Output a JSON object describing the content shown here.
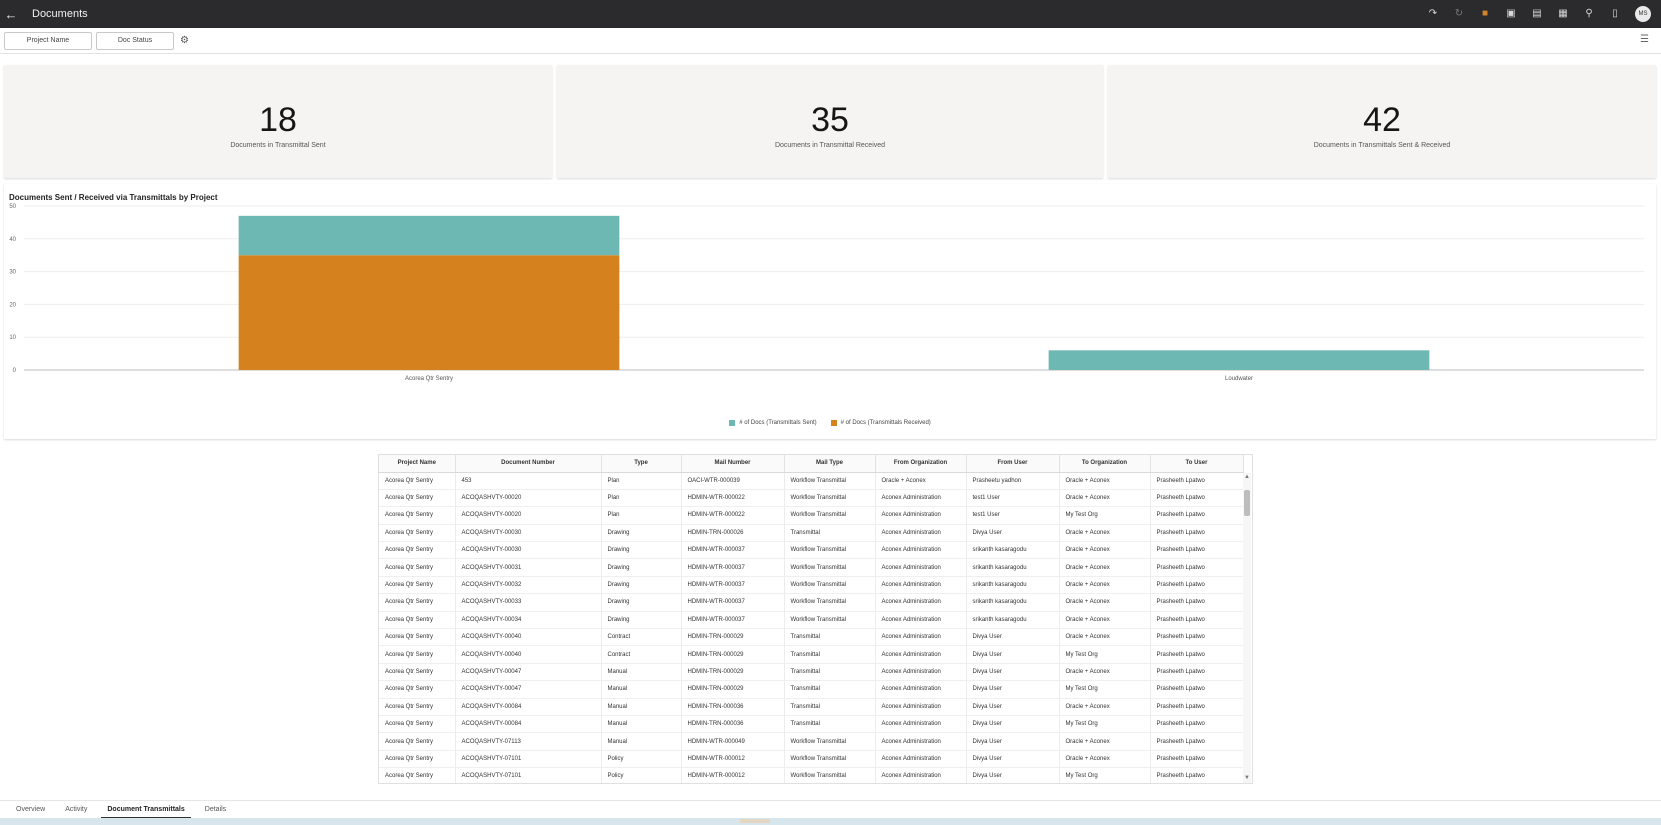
{
  "header": {
    "title": "Documents",
    "back_icon": "back-arrow-icon",
    "avatar_initials": "MS",
    "icons": [
      "share-icon",
      "redo-icon",
      "bookmark-icon",
      "present-icon",
      "notes-icon",
      "calendar-icon",
      "user-icon",
      "book-icon"
    ]
  },
  "filters": {
    "project_name": "Project Name",
    "doc_status": "Doc Status"
  },
  "kpis": [
    {
      "value": "18",
      "label": "Documents in Transmittal Sent"
    },
    {
      "value": "35",
      "label": "Documents in Transmittal Received"
    },
    {
      "value": "42",
      "label": "Documents in Transmittals Sent & Received"
    }
  ],
  "chart_data": {
    "type": "bar",
    "stacked": true,
    "title": "Documents Sent / Received via Transmittals by Project",
    "categories": [
      "Acorea Qtr Sentry",
      "Loudwater"
    ],
    "series": [
      {
        "name": "# of Docs (Transmittals Received)",
        "color": "#d5821e",
        "values": [
          35,
          0
        ]
      },
      {
        "name": "# of Docs (Transmittals Sent)",
        "color": "#6db8b3",
        "values": [
          12,
          6
        ]
      }
    ],
    "ylim": [
      0,
      50
    ],
    "yticks": [
      "0",
      "10",
      "20",
      "30",
      "40",
      "50"
    ],
    "legend_position": "bottom",
    "legend": [
      "# of Docs (Transmittals Sent)",
      "# of Docs (Transmittals Received)"
    ]
  },
  "table": {
    "columns": [
      "Project Name",
      "Document Number",
      "Type",
      "Mail Number",
      "Mail Type",
      "From Organization",
      "From User",
      "To Organization",
      "To User"
    ],
    "rows": [
      [
        "Acorea Qtr Sentry",
        "453",
        "Plan",
        "OACI-WTR-000039",
        "Workflow Transmittal",
        "Oracle + Aconex",
        "Prasheetu yadhon",
        "Oracle + Aconex",
        "Prasheeth Lpatwo"
      ],
      [
        "Acorea Qtr Sentry",
        "ACOQASHVTY-00020",
        "Plan",
        "HDMIN-WTR-000022",
        "Workflow Transmittal",
        "Aconex Administration",
        "test1 User",
        "Oracle + Aconex",
        "Prasheeth Lpatwo"
      ],
      [
        "Acorea Qtr Sentry",
        "ACOQASHVTY-00020",
        "Plan",
        "HDMIN-WTR-000022",
        "Workflow Transmittal",
        "Aconex Administration",
        "test1 User",
        "My Test Org",
        "Prasheeth Lpatwo"
      ],
      [
        "Acorea Qtr Sentry",
        "ACOQASHVTY-00030",
        "Drawing",
        "HDMIN-TRN-000026",
        "Transmittal",
        "Aconex Administration",
        "Divya User",
        "Oracle + Aconex",
        "Prasheeth Lpatwo"
      ],
      [
        "Acorea Qtr Sentry",
        "ACOQASHVTY-00030",
        "Drawing",
        "HDMIN-WTR-000037",
        "Workflow Transmittal",
        "Aconex Administration",
        "srikanth kasaragodu",
        "Oracle + Aconex",
        "Prasheeth Lpatwo"
      ],
      [
        "Acorea Qtr Sentry",
        "ACOQASHVTY-00031",
        "Drawing",
        "HDMIN-WTR-000037",
        "Workflow Transmittal",
        "Aconex Administration",
        "srikanth kasaragodu",
        "Oracle + Aconex",
        "Prasheeth Lpatwo"
      ],
      [
        "Acorea Qtr Sentry",
        "ACOQASHVTY-00032",
        "Drawing",
        "HDMIN-WTR-000037",
        "Workflow Transmittal",
        "Aconex Administration",
        "srikanth kasaragodu",
        "Oracle + Aconex",
        "Prasheeth Lpatwo"
      ],
      [
        "Acorea Qtr Sentry",
        "ACOQASHVTY-00033",
        "Drawing",
        "HDMIN-WTR-000037",
        "Workflow Transmittal",
        "Aconex Administration",
        "srikanth kasaragodu",
        "Oracle + Aconex",
        "Prasheeth Lpatwo"
      ],
      [
        "Acorea Qtr Sentry",
        "ACOQASHVTY-00034",
        "Drawing",
        "HDMIN-WTR-000037",
        "Workflow Transmittal",
        "Aconex Administration",
        "srikanth kasaragodu",
        "Oracle + Aconex",
        "Prasheeth Lpatwo"
      ],
      [
        "Acorea Qtr Sentry",
        "ACOQASHVTY-00040",
        "Contract",
        "HDMIN-TRN-000029",
        "Transmittal",
        "Aconex Administration",
        "Divya User",
        "Oracle + Aconex",
        "Prasheeth Lpatwo"
      ],
      [
        "Acorea Qtr Sentry",
        "ACOQASHVTY-00040",
        "Contract",
        "HDMIN-TRN-000029",
        "Transmittal",
        "Aconex Administration",
        "Divya User",
        "My Test Org",
        "Prasheeth Lpatwo"
      ],
      [
        "Acorea Qtr Sentry",
        "ACOQASHVTY-00047",
        "Manual",
        "HDMIN-TRN-000029",
        "Transmittal",
        "Aconex Administration",
        "Divya User",
        "Oracle + Aconex",
        "Prasheeth Lpatwo"
      ],
      [
        "Acorea Qtr Sentry",
        "ACOQASHVTY-00047",
        "Manual",
        "HDMIN-TRN-000029",
        "Transmittal",
        "Aconex Administration",
        "Divya User",
        "My Test Org",
        "Prasheeth Lpatwo"
      ],
      [
        "Acorea Qtr Sentry",
        "ACOQASHVTY-00084",
        "Manual",
        "HDMIN-TRN-000036",
        "Transmittal",
        "Aconex Administration",
        "Divya User",
        "Oracle + Aconex",
        "Prasheeth Lpatwo"
      ],
      [
        "Acorea Qtr Sentry",
        "ACOQASHVTY-00084",
        "Manual",
        "HDMIN-TRN-000036",
        "Transmittal",
        "Aconex Administration",
        "Divya User",
        "My Test Org",
        "Prasheeth Lpatwo"
      ],
      [
        "Acorea Qtr Sentry",
        "ACOQASHVTY-07113",
        "Manual",
        "HDMIN-WTR-000049",
        "Workflow Transmittal",
        "Aconex Administration",
        "Divya User",
        "Oracle + Aconex",
        "Prasheeth Lpatwo"
      ],
      [
        "Acorea Qtr Sentry",
        "ACOQASHVTY-07101",
        "Policy",
        "HDMIN-WTR-000012",
        "Workflow Transmittal",
        "Aconex Administration",
        "Divya User",
        "Oracle + Aconex",
        "Prasheeth Lpatwo"
      ],
      [
        "Acorea Qtr Sentry",
        "ACOQASHVTY-07101",
        "Policy",
        "HDMIN-WTR-000012",
        "Workflow Transmittal",
        "Aconex Administration",
        "Divya User",
        "My Test Org",
        "Prasheeth Lpatwo"
      ]
    ]
  },
  "tabs": [
    "Overview",
    "Activity",
    "Document Transmittals",
    "Details"
  ],
  "active_tab": "Document Transmittals"
}
